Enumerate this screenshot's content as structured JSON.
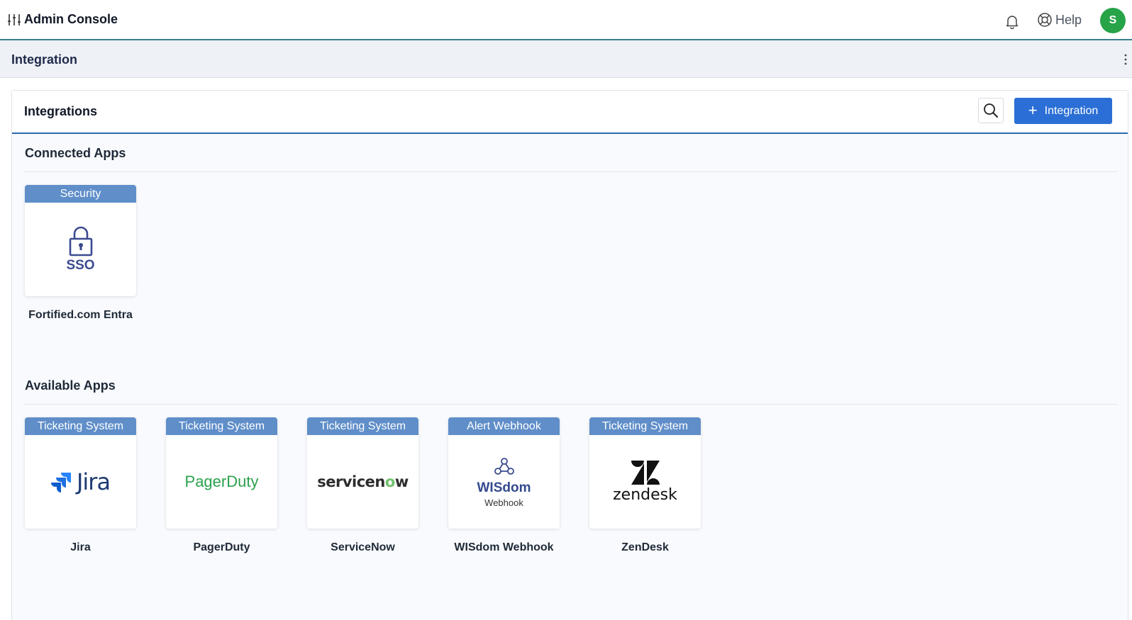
{
  "topbar": {
    "app_title": "Admin Console",
    "logo_icon": "sliders-icon",
    "notification_icon": "bell-icon",
    "help_label": "Help",
    "help_icon": "lifebuoy-icon",
    "avatar_initial": "S",
    "avatar_color": "#27a348"
  },
  "page_header": {
    "title": "Integration",
    "menu_icon": "kebab-icon"
  },
  "panel": {
    "title": "Integrations",
    "search_icon": "search-icon",
    "add_button_label": "Integration",
    "add_button_color": "#2b6fd6"
  },
  "connected": {
    "section_title": "Connected Apps",
    "apps": [
      {
        "category": "Security",
        "logo_text": "SSO",
        "name": "Fortified.com Entra"
      }
    ]
  },
  "available": {
    "section_title": "Available Apps",
    "apps": [
      {
        "category": "Ticketing System",
        "logo_text": "Jira",
        "name": "Jira"
      },
      {
        "category": "Ticketing System",
        "logo_text": "PagerDuty",
        "name": "PagerDuty"
      },
      {
        "category": "Ticketing System",
        "logo_text_a": "servicen",
        "logo_text_b": "o",
        "logo_text_c": "w",
        "name": "ServiceNow"
      },
      {
        "category": "Alert Webhook",
        "logo_text": "WISdom",
        "logo_subtext": "Webhook",
        "name": "WISdom Webhook"
      },
      {
        "category": "Ticketing System",
        "logo_text": "zendesk",
        "name": "ZenDesk"
      }
    ]
  },
  "colors": {
    "badge": "#5f8ec9",
    "header_accent": "#2e6ab4",
    "pagerduty_green": "#2aa14d",
    "jira_blue": "#2684ff"
  }
}
